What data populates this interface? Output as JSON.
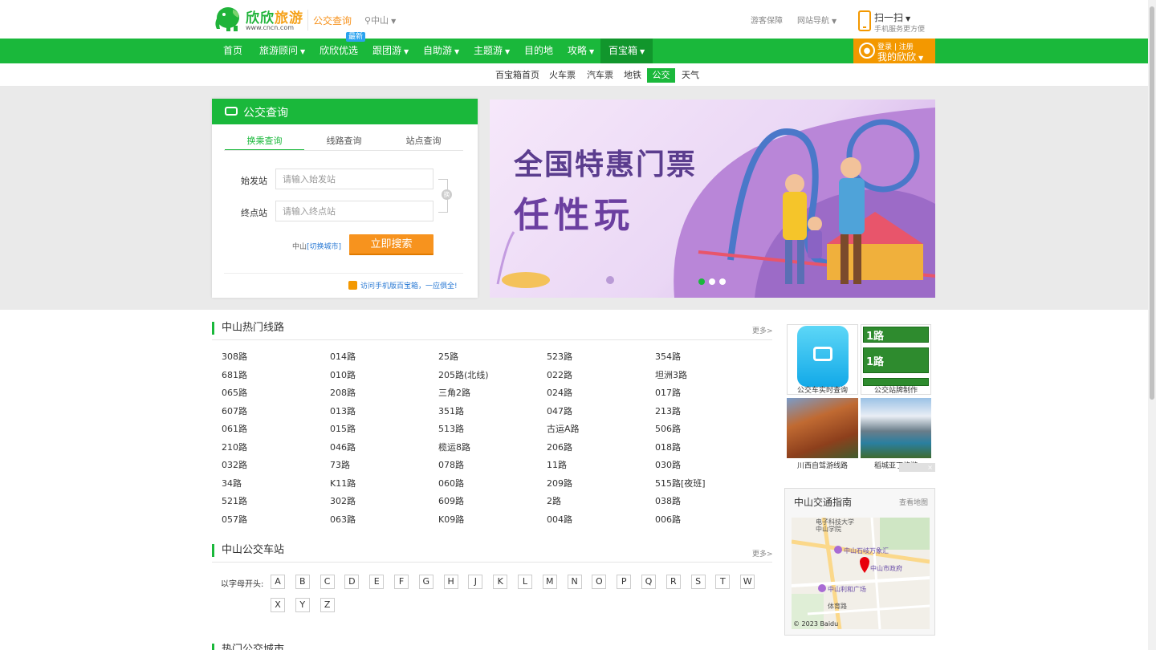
{
  "header": {
    "logo_text_a": "欣欣",
    "logo_text_b": "旅游",
    "logo_url": "www.cncn.com",
    "page_title": "公交查询",
    "city": "中山",
    "links": [
      "游客保障",
      "网站导航"
    ],
    "scan_title": "扫一扫",
    "scan_sub": "手机服务更方便"
  },
  "nav": {
    "items": [
      "首页",
      "旅游顾问",
      "欣欣优选",
      "跟团游",
      "自助游",
      "主题游",
      "目的地",
      "攻略",
      "百宝箱"
    ],
    "badge": "最新",
    "login": "登录",
    "register": "注册",
    "my": "我的欣欣"
  },
  "subnav": {
    "items": [
      "百宝箱首页",
      "火车票",
      "汽车票",
      "地铁",
      "公交",
      "天气"
    ],
    "active": "公交"
  },
  "search_panel": {
    "title": "公交查询",
    "tabs": [
      "换乘查询",
      "线路查询",
      "站点查询"
    ],
    "start_label": "始发站",
    "start_placeholder": "请输入始发站",
    "end_label": "终点站",
    "end_placeholder": "请输入终点站",
    "swap": "换",
    "city": "中山",
    "switch_city": "[切换城市]",
    "search_button": "立即搜索",
    "mobile_tip": "访问手机版百宝箱，一应俱全!"
  },
  "banner": {
    "line1": "全国特惠门票",
    "line2": "任性玩"
  },
  "hot_routes": {
    "title": "中山热门线路",
    "more": "更多>",
    "rows": [
      [
        "308路",
        "014路",
        "25路",
        "523路",
        "354路"
      ],
      [
        "681路",
        "010路",
        "205路(北线)",
        "022路",
        "坦洲3路"
      ],
      [
        "065路",
        "208路",
        "三角2路",
        "024路",
        "017路"
      ],
      [
        "607路",
        "013路",
        "351路",
        "047路",
        "213路"
      ],
      [
        "061路",
        "015路",
        "513路",
        "古运A路",
        "506路"
      ],
      [
        "210路",
        "046路",
        "榄运8路",
        "206路",
        "018路"
      ],
      [
        "032路",
        "73路",
        "078路",
        "11路",
        "030路"
      ],
      [
        "34路",
        "K11路",
        "060路",
        "209路",
        "515路[夜班]"
      ],
      [
        "521路",
        "302路",
        "609路",
        "2路",
        "038路"
      ],
      [
        "057路",
        "063路",
        "K09路",
        "004路",
        "006路"
      ]
    ]
  },
  "stations": {
    "title": "中山公交车站",
    "more": "更多>",
    "letter_label": "以字母开头:",
    "letters": [
      "A",
      "B",
      "C",
      "D",
      "E",
      "F",
      "G",
      "H",
      "J",
      "K",
      "L",
      "M",
      "N",
      "O",
      "P",
      "Q",
      "R",
      "S",
      "T",
      "W",
      "X",
      "Y",
      "Z"
    ]
  },
  "side": {
    "app_caption": "公交车实时查询",
    "sign_caption": "公交站牌制作",
    "sign_number": "1路",
    "photo1_caption": "川西自驾游线路",
    "photo2_caption": "稻城亚丁旅游",
    "close": "×",
    "map_title": "中山交通指南",
    "map_link": "查看地图",
    "map_labels": [
      "电子科技大学",
      "中山学院",
      "中山石岐万象汇",
      "中山市政府",
      "中山利和广场",
      "体育路"
    ],
    "map_copyright": "© 2023 Baidu"
  },
  "next_section_title": "热门公交城市",
  "colors": {
    "green": "#1ab83b",
    "orange": "#f7931e",
    "link_blue": "#2a7ad4"
  }
}
